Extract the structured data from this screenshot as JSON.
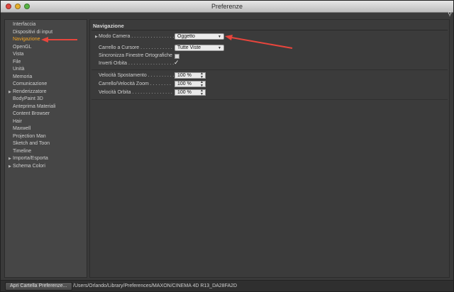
{
  "window": {
    "title": "Preferenze"
  },
  "sidebar": {
    "items": [
      {
        "label": "Interfaccia",
        "active": false,
        "expandable": false
      },
      {
        "label": "Dispositivi di input",
        "active": false,
        "expandable": false
      },
      {
        "label": "Navigazione",
        "active": true,
        "expandable": false
      },
      {
        "label": "OpenGL",
        "active": false,
        "expandable": false
      },
      {
        "label": "Vista",
        "active": false,
        "expandable": false
      },
      {
        "label": "File",
        "active": false,
        "expandable": false
      },
      {
        "label": "Unità",
        "active": false,
        "expandable": false
      },
      {
        "label": "Memoria",
        "active": false,
        "expandable": false
      },
      {
        "label": "Comunicazione",
        "active": false,
        "expandable": false
      },
      {
        "label": "Renderizzatore",
        "active": false,
        "expandable": true
      },
      {
        "label": "BodyPaint 3D",
        "active": false,
        "expandable": false
      },
      {
        "label": "Anteprima Materiali",
        "active": false,
        "expandable": false
      },
      {
        "label": "Content Browser",
        "active": false,
        "expandable": false
      },
      {
        "label": "Hair",
        "active": false,
        "expandable": false
      },
      {
        "label": "Maxwell",
        "active": false,
        "expandable": false
      },
      {
        "label": "Projection Man",
        "active": false,
        "expandable": false
      },
      {
        "label": "Sketch and Toon",
        "active": false,
        "expandable": false
      },
      {
        "label": "Timeline",
        "active": false,
        "expandable": false
      },
      {
        "label": "Importa/Esporta",
        "active": false,
        "expandable": true
      },
      {
        "label": "Schema Colori",
        "active": false,
        "expandable": true
      }
    ]
  },
  "content": {
    "section_title": "Navigazione",
    "modo_camera": {
      "label": "Modo Camera . . . . . . . . . . . . . . . . .",
      "value": "Oggetto"
    },
    "carrello_cursore": {
      "label": "Carrello a Cursore . . . . . . . . . . . .",
      "value": "Tutte Viste"
    },
    "sincronizza": {
      "label": "Sincronizza Finestre Ortografiche",
      "checked": false
    },
    "inverti_orbita": {
      "label": "Inverti Orbita . . . . . . . . . . . . . . . . .",
      "checked": true
    },
    "velocita_spostamento": {
      "label": "Velocità Spostamento . . . . . . . . . .",
      "value": "100 %"
    },
    "carrello_zoom": {
      "label": "Carrello/Velocità Zoom . . . . . . . .",
      "value": "100 %"
    },
    "velocita_orbita": {
      "label": "Velocità Orbita . . . . . . . . . . . . . . .",
      "value": "100 %"
    }
  },
  "footer": {
    "open_button": "Apri Cartella Preferenze...",
    "path": "/Users/Orlando/Library/Preferences/MAXON/CINEMA 4D R13_DA28FA2D"
  },
  "colors": {
    "active_item": "#f6a623",
    "annotation_arrow": "#e8453c"
  }
}
